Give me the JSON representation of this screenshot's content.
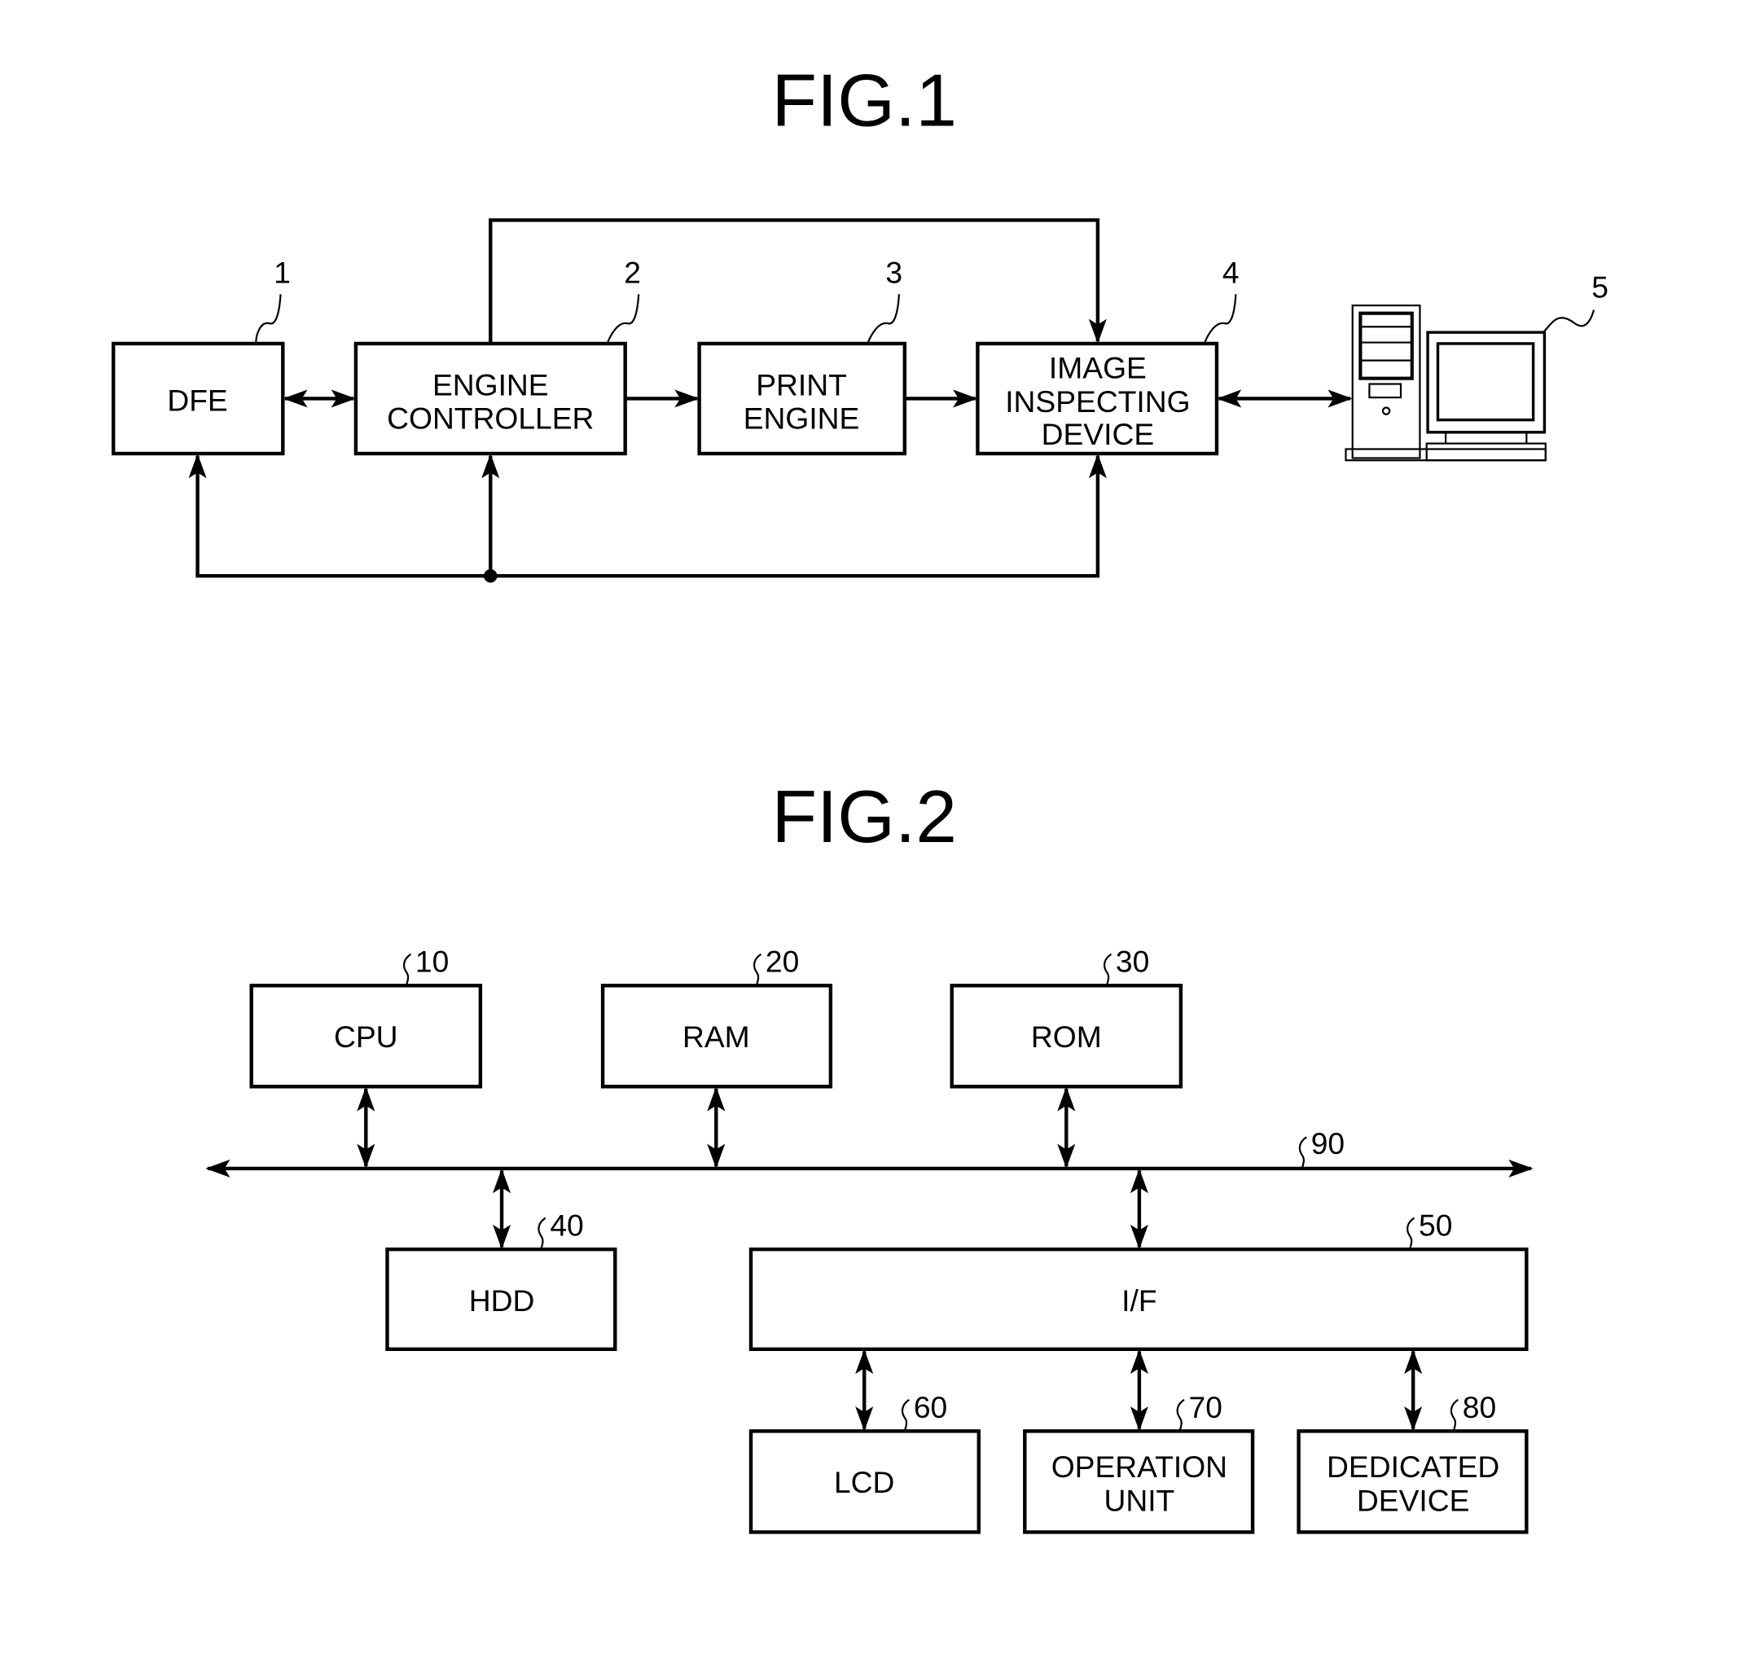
{
  "fig1": {
    "title": "FIG.1",
    "blocks": {
      "dfe": {
        "ref": "1",
        "lines": [
          "DFE"
        ]
      },
      "engine_controller": {
        "ref": "2",
        "lines": [
          "ENGINE",
          "CONTROLLER"
        ]
      },
      "print_engine": {
        "ref": "3",
        "lines": [
          "PRINT",
          "ENGINE"
        ]
      },
      "image_inspecting_device": {
        "ref": "4",
        "lines": [
          "IMAGE",
          "INSPECTING",
          "DEVICE"
        ]
      },
      "computer": {
        "ref": "5",
        "icon": "desktop-computer-icon"
      }
    },
    "connections": [
      {
        "from": "DFE",
        "to": "ENGINE CONTROLLER",
        "type": "bidirectional"
      },
      {
        "from": "ENGINE CONTROLLER",
        "to": "PRINT ENGINE",
        "type": "directed"
      },
      {
        "from": "PRINT ENGINE",
        "to": "IMAGE INSPECTING DEVICE",
        "type": "directed"
      },
      {
        "from": "IMAGE INSPECTING DEVICE",
        "to": "computer 5",
        "type": "bidirectional"
      },
      {
        "from": "ENGINE CONTROLLER",
        "to": "IMAGE INSPECTING DEVICE",
        "type": "directed",
        "route": "top"
      },
      {
        "from": "bottom junction",
        "to": [
          "DFE",
          "ENGINE CONTROLLER",
          "IMAGE INSPECTING DEVICE"
        ],
        "type": "directed",
        "route": "bottom"
      }
    ]
  },
  "fig2": {
    "title": "FIG.2",
    "bus": {
      "ref": "90"
    },
    "blocks": {
      "cpu": {
        "ref": "10",
        "lines": [
          "CPU"
        ]
      },
      "ram": {
        "ref": "20",
        "lines": [
          "RAM"
        ]
      },
      "rom": {
        "ref": "30",
        "lines": [
          "ROM"
        ]
      },
      "hdd": {
        "ref": "40",
        "lines": [
          "HDD"
        ]
      },
      "if": {
        "ref": "50",
        "lines": [
          "I/F"
        ]
      },
      "lcd": {
        "ref": "60",
        "lines": [
          "LCD"
        ]
      },
      "operation_unit": {
        "ref": "70",
        "lines": [
          "OPERATION",
          "UNIT"
        ]
      },
      "dedicated_device": {
        "ref": "80",
        "lines": [
          "DEDICATED",
          "DEVICE"
        ]
      }
    }
  }
}
